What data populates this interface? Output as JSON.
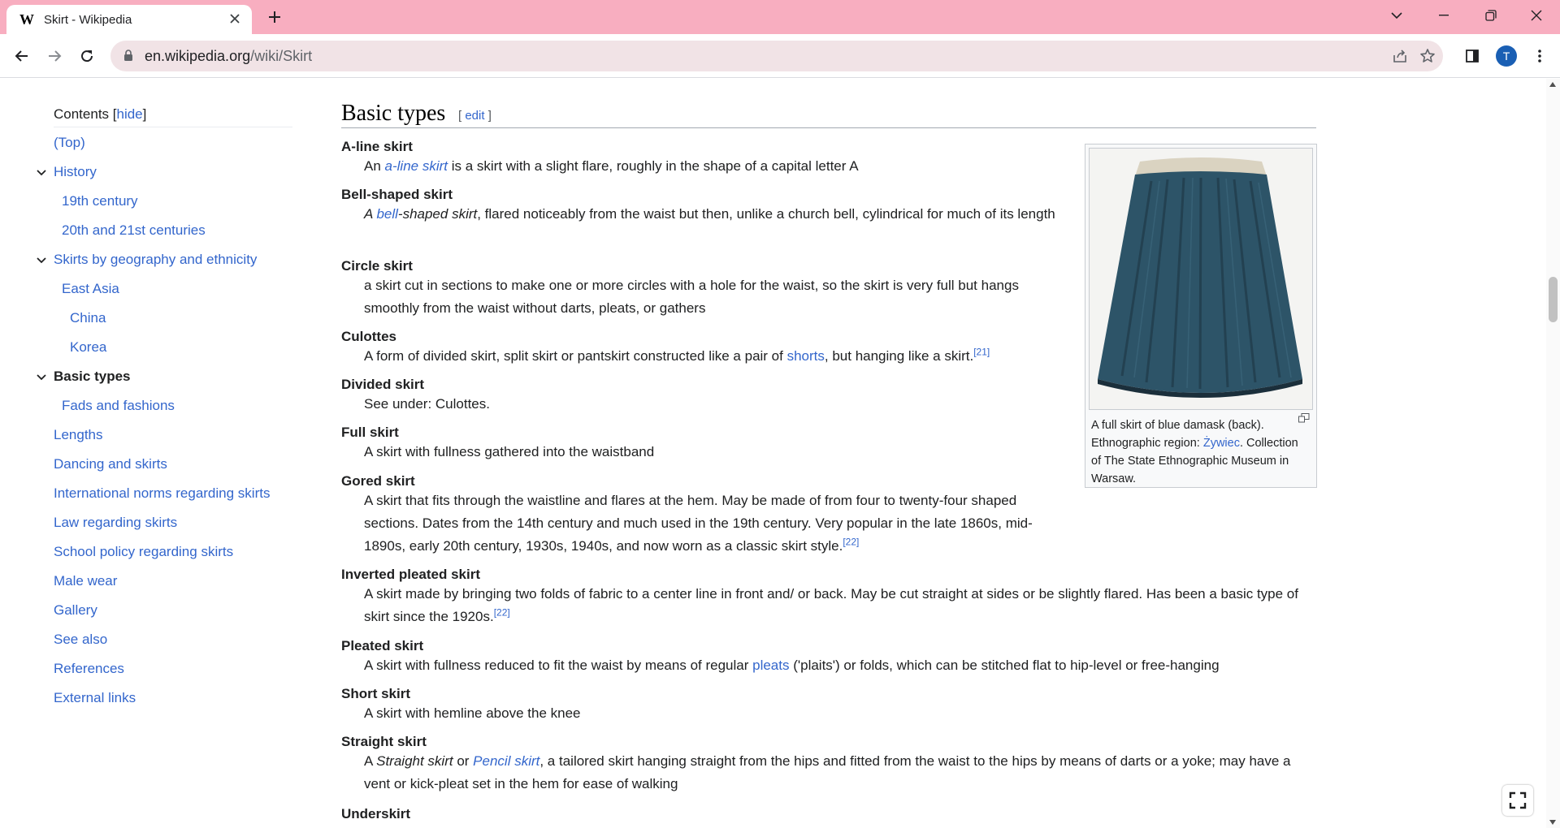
{
  "browser": {
    "tab_title": "Skirt - Wikipedia",
    "favicon": "W",
    "url_host": "en.wikipedia.org",
    "url_path": "/wiki/Skirt",
    "profile_initial": "T",
    "accent_color": "#f8aec0"
  },
  "toc": {
    "heading": "Contents",
    "hide_label": "hide",
    "items": [
      {
        "label": "(Top)"
      },
      {
        "label": "History"
      },
      {
        "label": "19th century"
      },
      {
        "label": "20th and 21st centuries"
      },
      {
        "label": "Skirts by geography and ethnicity"
      },
      {
        "label": "East Asia"
      },
      {
        "label": "China"
      },
      {
        "label": "Korea"
      },
      {
        "label": "Basic types"
      },
      {
        "label": "Fads and fashions"
      },
      {
        "label": "Lengths"
      },
      {
        "label": "Dancing and skirts"
      },
      {
        "label": "International norms regarding skirts"
      },
      {
        "label": "Law regarding skirts"
      },
      {
        "label": "School policy regarding skirts"
      },
      {
        "label": "Male wear"
      },
      {
        "label": "Gallery"
      },
      {
        "label": "See also"
      },
      {
        "label": "References"
      },
      {
        "label": "External links"
      }
    ]
  },
  "section": {
    "title": "Basic types",
    "edit_label": "edit"
  },
  "types": {
    "aline": {
      "term": "A-line skirt",
      "pre": "An ",
      "link": "a-line skirt",
      "post": " is a skirt with a slight flare, roughly in the shape of a capital letter A"
    },
    "bell": {
      "term": "Bell-shaped skirt",
      "pre": "A ",
      "link": "bell",
      "mid": "-shaped skirt",
      "post": ", flared noticeably from the waist but then, unlike a church bell, cylindrical for much of its length"
    },
    "circle": {
      "term": "Circle skirt",
      "text": "a skirt cut in sections to make one or more circles with a hole for the waist, so the skirt is very full but hangs smoothly from the waist without darts, pleats, or gathers"
    },
    "culottes": {
      "term": "Culottes",
      "pre": "A form of divided skirt, split skirt or pantskirt constructed like a pair of ",
      "link": "shorts",
      "post": ", but hanging like a skirt.",
      "ref": "[21]"
    },
    "divided": {
      "term": "Divided skirt",
      "text": "See under: Culottes."
    },
    "full": {
      "term": "Full skirt",
      "text": "A skirt with fullness gathered into the waistband"
    },
    "gored": {
      "term": "Gored skirt",
      "text": "A skirt that fits through the waistline and flares at the hem. May be made of from four to twenty-four shaped sections. Dates from the 14th century and much used in the 19th century. Very popular in the late 1860s, mid-1890s, early 20th century, 1930s, 1940s, and now worn as a classic skirt style.",
      "ref": "[22]"
    },
    "inverted": {
      "term": "Inverted pleated skirt",
      "text": "A skirt made by bringing two folds of fabric to a center line in front and/ or back. May be cut straight at sides or be slightly flared. Has been a basic type of skirt since the 1920s.",
      "ref": "[22]"
    },
    "pleated": {
      "term": "Pleated skirt",
      "pre": "A skirt with fullness reduced to fit the waist by means of regular ",
      "link": "pleats",
      "post": " ('plaits') or folds, which can be stitched flat to hip-level or free-hanging"
    },
    "short": {
      "term": "Short skirt",
      "text": "A skirt with hemline above the knee"
    },
    "straight": {
      "term": "Straight skirt",
      "pre": "A ",
      "em": "Straight skirt",
      "or": " or ",
      "link": "Pencil skirt",
      "post": ", a tailored skirt hanging straight from the hips and fitted from the waist to the hips by means of darts or a yoke; may have a vent or kick-pleat set in the hem for ease of walking"
    },
    "under": {
      "term": "Underskirt"
    }
  },
  "thumbnail": {
    "caption_1": "A full skirt of blue damask (back). Ethnographic region: ",
    "caption_link": "Żywiec",
    "caption_2": ". Collection of The State Ethnographic Museum in Warsaw."
  }
}
